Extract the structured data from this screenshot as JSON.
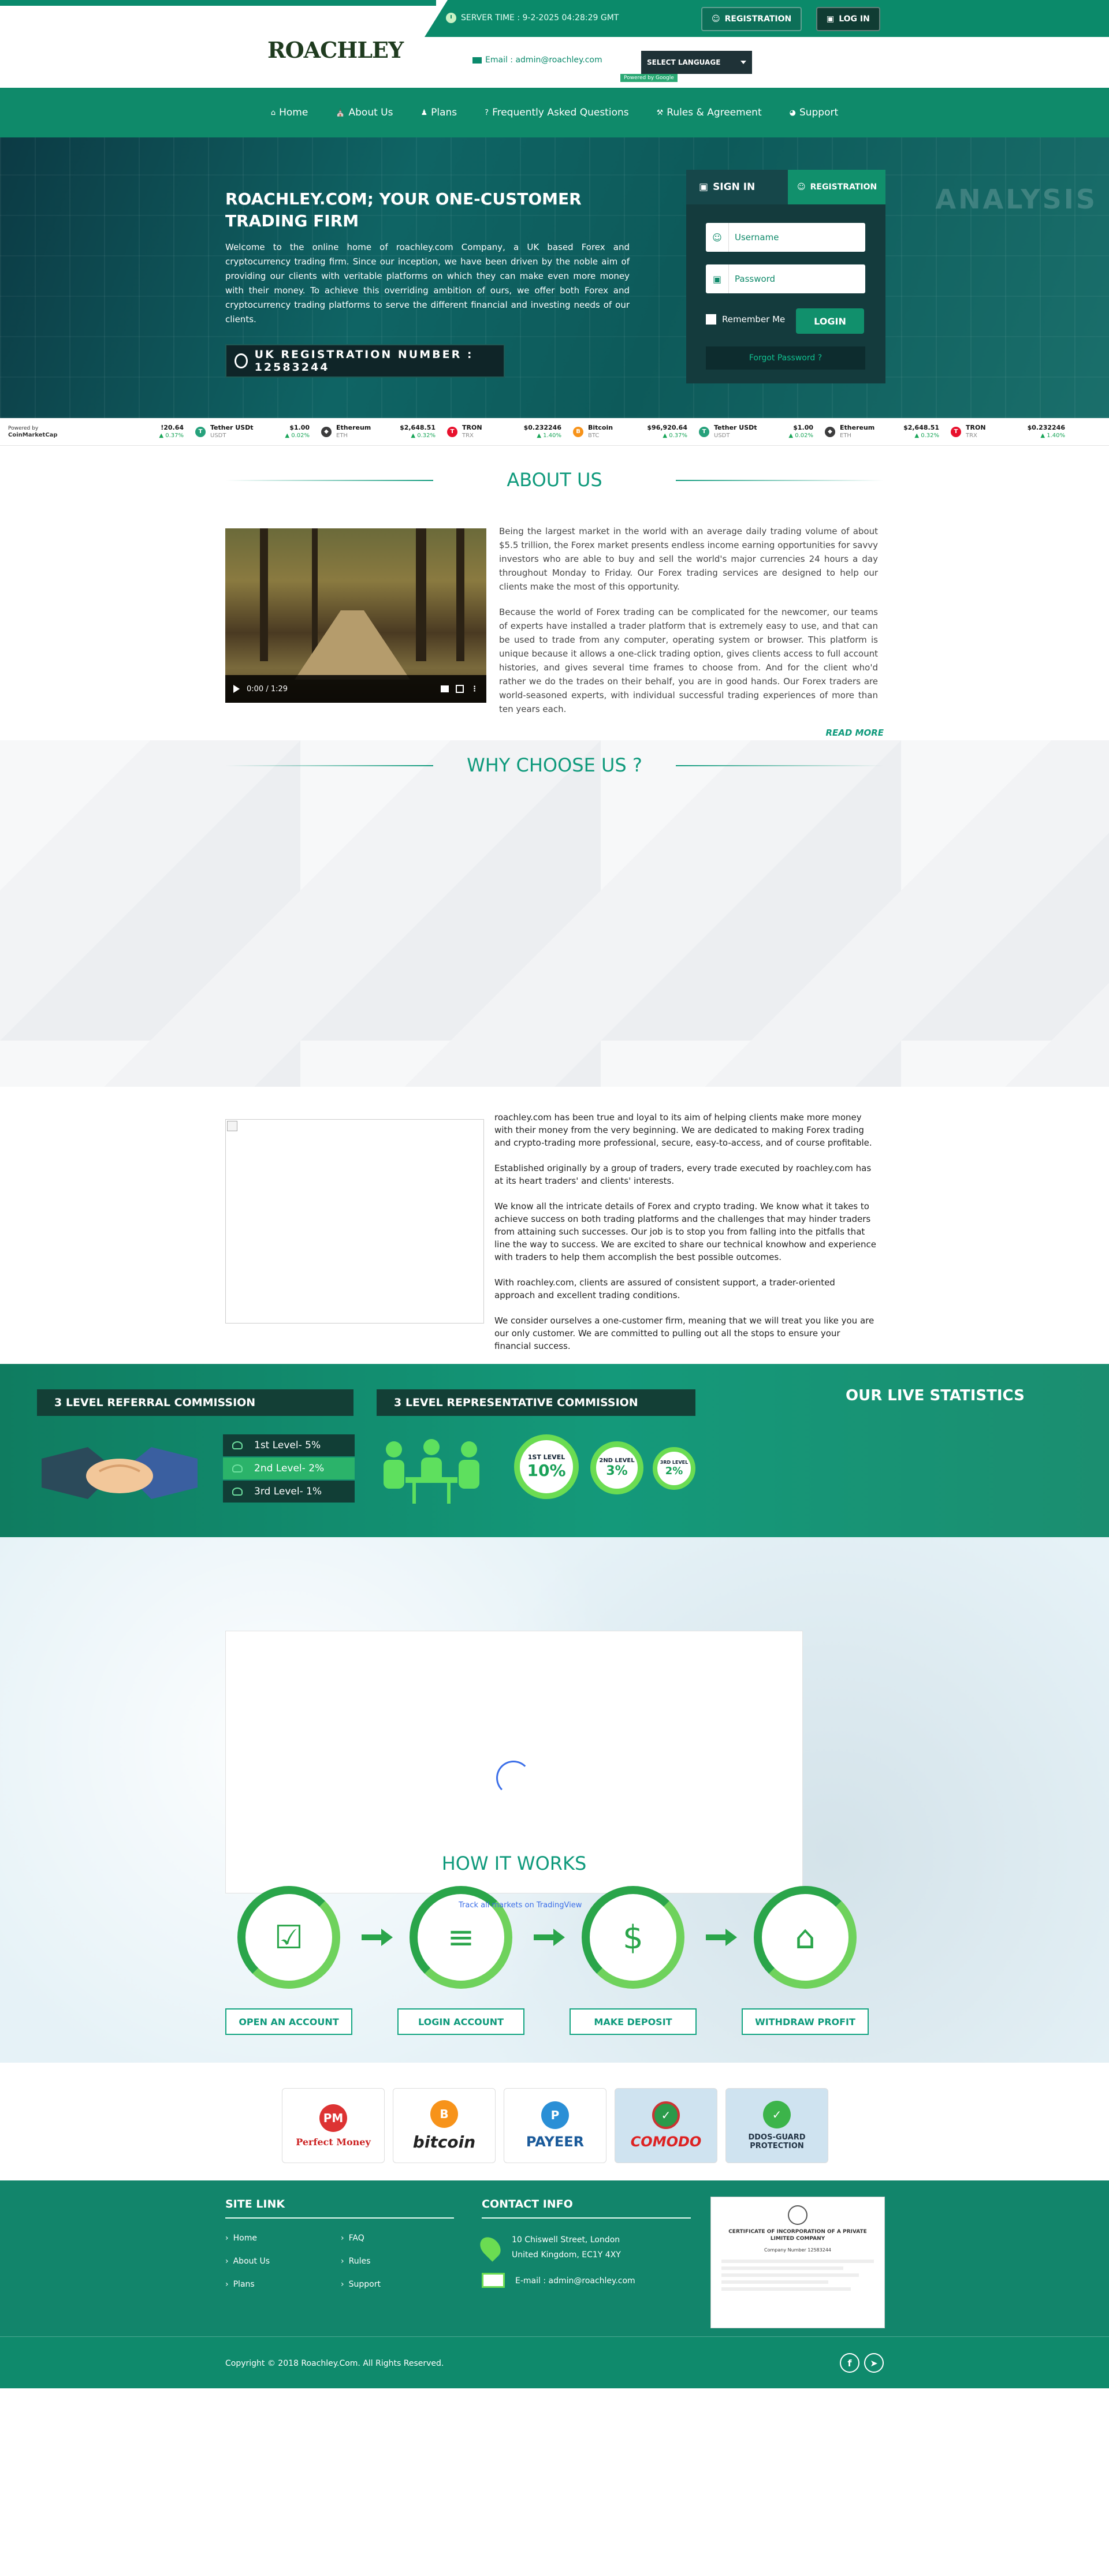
{
  "topbar": {
    "logo": "ROACHLEY",
    "server_time": "SERVER TIME : 9-2-2025 04:28:29 GMT",
    "registration_label": "REGISTRATION",
    "login_label": "LOG IN",
    "email_line": "Email : admin@roachley.com",
    "language_label": "SELECT LANGUAGE",
    "translate_tag": "Powered by Google"
  },
  "nav": {
    "items": [
      {
        "label": "Home",
        "icon": "home-icon"
      },
      {
        "label": "About Us",
        "icon": "bank-icon"
      },
      {
        "label": "Plans",
        "icon": "users-icon"
      },
      {
        "label": "Frequently Asked Questions",
        "icon": "question-icon"
      },
      {
        "label": "Rules & Agreement",
        "icon": "wrench-icon"
      },
      {
        "label": "Support",
        "icon": "support-icon"
      }
    ]
  },
  "hero": {
    "title": "ROACHLEY.COM; YOUR ONE-CUSTOMER TRADING FIRM",
    "text": "Welcome to the online home of roachley.com Company, a UK based Forex and cryptocurrency trading firm. Since our inception, we have been driven by the noble aim of providing our clients with veritable platforms on which they can make even more money with their money. To achieve this overriding ambition of ours, we offer both Forex and cryptocurrency trading platforms to serve the different financial and investing needs of our clients.",
    "registration_number": "UK REGISTRATION NUMBER : 12583244",
    "background_word": "ANALYSIS"
  },
  "login_card": {
    "signin_tab": "SIGN IN",
    "registration_tab": "REGISTRATION",
    "username_placeholder": "Username",
    "password_placeholder": "Password",
    "remember_label": "Remember Me",
    "login_button": "LOGIN",
    "forgot_label": "Forgot Password ?"
  },
  "ticker": {
    "brand_small": "Powered by",
    "brand": "CoinMarketCap",
    "items": [
      {
        "name": "",
        "symbol": "",
        "price": "!20.64",
        "change": "▲ 0.37%",
        "color": "#f0b90b",
        "glyph": ""
      },
      {
        "name": "Tether USDt",
        "symbol": "USDT",
        "price": "$1.00",
        "change": "▲ 0.02%",
        "color": "#26a17b",
        "glyph": "T"
      },
      {
        "name": "Ethereum",
        "symbol": "ETH",
        "price": "$2,648.51",
        "change": "▲ 0.32%",
        "color": "#3c3c3d",
        "glyph": "◆"
      },
      {
        "name": "TRON",
        "symbol": "TRX",
        "price": "$0.232246",
        "change": "▲ 1.40%",
        "color": "#e8112d",
        "glyph": "T"
      },
      {
        "name": "Bitcoin",
        "symbol": "BTC",
        "price": "$96,920.64",
        "change": "▲ 0.37%",
        "color": "#f7931a",
        "glyph": "B"
      },
      {
        "name": "Tether USDt",
        "symbol": "USDT",
        "price": "$1.00",
        "change": "▲ 0.02%",
        "color": "#26a17b",
        "glyph": "T"
      },
      {
        "name": "Ethereum",
        "symbol": "ETH",
        "price": "$2,648.51",
        "change": "▲ 0.32%",
        "color": "#3c3c3d",
        "glyph": "◆"
      },
      {
        "name": "TRON",
        "symbol": "TRX",
        "price": "$0.232246",
        "change": "▲ 1.40%",
        "color": "#e8112d",
        "glyph": "T"
      }
    ]
  },
  "about": {
    "title": "ABOUT US",
    "video_time": "0:00 / 1:29",
    "p1": "Being the largest market in the world with an average daily trading volume of about $5.5 trillion, the Forex market presents endless income earning opportunities for savvy investors who are able to buy and sell the world's major currencies 24 hours a day throughout Monday to Friday. Our Forex trading services are designed to help our clients make the most of this opportunity.",
    "p2": "Because the world of Forex trading can be complicated for the newcomer, our teams of experts have installed a trader platform that is extremely easy to use, and that can be used to trade from any computer, operating system or browser. This platform is unique because it allows a one-click trading option, gives clients access to full account histories, and gives several time frames to choose from. And for the client who'd rather we do the trades on their behalf, you are in good hands. Our Forex traders are world-seasoned experts, with individual successful trading experiences of more than ten years each.",
    "read_more": "READ MORE"
  },
  "why": {
    "title": "WHY CHOOSE US ?"
  },
  "info": {
    "paragraphs": [
      "roachley.com has been true and loyal to its aim of helping clients make more money with their money from the very beginning. We are dedicated to making Forex trading and crypto-trading more professional, secure, easy-to-access, and of course profitable.",
      "Established originally by a group of traders, every trade executed by roachley.com has at its heart traders' and clients' interests.",
      "We know all the intricate details of Forex and crypto trading. We know what it takes to achieve success on both trading platforms and the challenges that may hinder traders from attaining such successes. Our job is to stop you from falling into the pitfalls that line the way to success. We are excited to share our technical knowhow and experience with traders to help them accomplish the best possible outcomes.",
      "With roachley.com, clients are assured of consistent support, a trader-oriented approach and excellent trading conditions.",
      "We consider ourselves a one-customer firm, meaning that we will treat you like you are our only customer. We are committed to pulling out all the stops to ensure your financial success."
    ]
  },
  "commission": {
    "referral_title": "3 LEVEL REFERRAL COMMISSION",
    "representative_title": "3 LEVEL REPRESENTATIVE COMMISSION",
    "stats_title": "OUR LIVE STATISTICS",
    "levels": [
      "1st Level- 5%",
      "2nd Level- 2%",
      "3rd Level- 1%"
    ],
    "rings": [
      {
        "label": "1ST LEVEL",
        "value": "10%"
      },
      {
        "label": "2ND LEVEL",
        "value": "3%"
      },
      {
        "label": "3RD LEVEL",
        "value": "2%"
      }
    ]
  },
  "how": {
    "title": "HOW IT WORKS",
    "tv_link": "Track all markets on TradingView",
    "steps": [
      {
        "label": "OPEN AN ACCOUNT",
        "icon": "form-icon",
        "glyph": "☑"
      },
      {
        "label": "LOGIN ACCOUNT",
        "icon": "login-panel-icon",
        "glyph": "≡"
      },
      {
        "label": "MAKE DEPOSIT",
        "icon": "coins-icon",
        "glyph": "$"
      },
      {
        "label": "WITHDRAW PROFIT",
        "icon": "cart-icon",
        "glyph": "⌂"
      }
    ]
  },
  "partners": [
    {
      "name": "Perfect Money",
      "badge": "PM",
      "color": "#d33",
      "text_color": "#c22"
    },
    {
      "name": "bitcoin",
      "badge": "B",
      "color": "#f7931a",
      "text_color": "#222"
    },
    {
      "name": "PAYEER",
      "badge": "P",
      "color": "#2a8fd6",
      "text_color": "#1a5a9a"
    },
    {
      "name": "COMODO",
      "badge": "✓",
      "color": "#2a9a4a",
      "text_color": "#d22"
    },
    {
      "name": "DDOS-GUARD PROTECTION",
      "badge": "✓",
      "color": "#3cb44a",
      "text_color": "#234"
    }
  ],
  "footer": {
    "site_link_title": "SITE LINK",
    "contact_title": "CONTACT INFO",
    "links": [
      "Home",
      "FAQ",
      "About Us",
      "Rules",
      "Plans",
      "Support"
    ],
    "address_line1": "10 Chiswell Street, London",
    "address_line2": "United Kingdom, EC1Y 4XY",
    "email": "E-mail : admin@roachley.com",
    "cert_title": "CERTIFICATE OF INCORPORATION OF A PRIVATE LIMITED COMPANY",
    "cert_line": "Company Number 12583244",
    "copyright": "Copyright © 2018 Roachley.Com. All Rights Reserved."
  }
}
